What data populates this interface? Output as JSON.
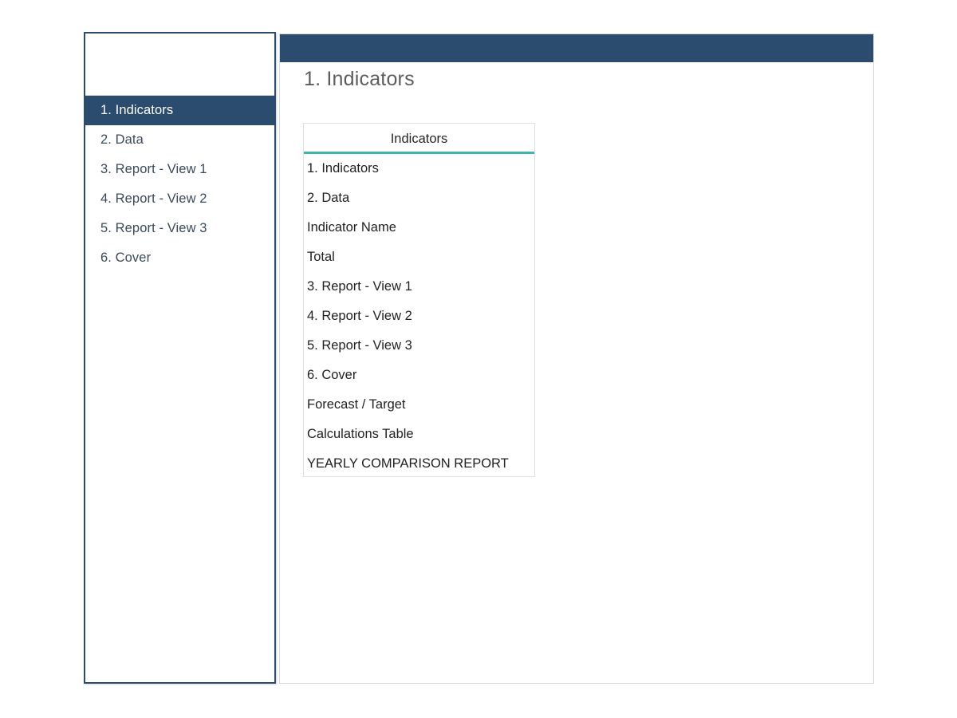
{
  "theme": {
    "navy": "#2b4b6f",
    "teal_accent": "#3eb5ad",
    "sidebar_text": "#3a4a5c",
    "title_gray": "#5d5d5d",
    "panel_border": "#d3d6da",
    "page_background": "#ffffff"
  },
  "sidebar": {
    "items": [
      {
        "label": "1. Indicators",
        "active": true
      },
      {
        "label": "2. Data",
        "active": false
      },
      {
        "label": "3. Report - View 1",
        "active": false
      },
      {
        "label": "4. Report - View 2",
        "active": false
      },
      {
        "label": "5. Report - View 3",
        "active": false
      },
      {
        "label": "6. Cover",
        "active": false
      }
    ]
  },
  "main": {
    "page_title": "1. Indicators",
    "indicators_card": {
      "header": "Indicators",
      "rows": [
        "1. Indicators",
        "2. Data",
        "Indicator Name",
        "Total",
        "3. Report - View 1",
        "4. Report - View 2",
        "5. Report - View 3",
        "6. Cover",
        "Forecast / Target",
        "Calculations Table",
        "YEARLY COMPARISON REPORT"
      ]
    }
  }
}
